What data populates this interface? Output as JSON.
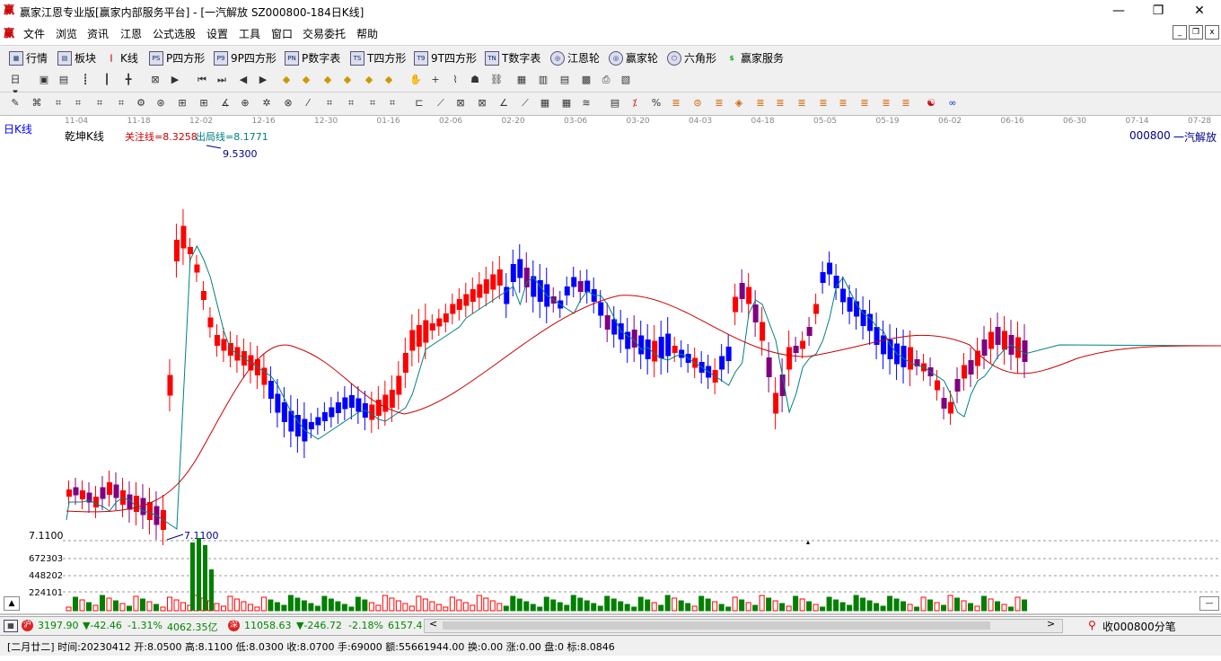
{
  "titlebar": {
    "title": "赢家江恩专业版[赢家内部服务平台] - [一汽解放  SZ000800-184日K线]",
    "logo": "赢"
  },
  "menu": [
    "文件",
    "浏览",
    "资讯",
    "江恩",
    "公式选股",
    "设置",
    "工具",
    "窗口",
    "交易委托",
    "帮助"
  ],
  "toolbar1": [
    "行情",
    "板块",
    "K线",
    "P四方形",
    "9P四方形",
    "P数字表",
    "T四方形",
    "9T四方形",
    "T数字表",
    "江恩轮",
    "赢家轮",
    "六角形",
    "赢家服务"
  ],
  "chart": {
    "period": "日K线",
    "indicator_name": "乾坤K线",
    "indicator_v1": "关注线=8.3258",
    "indicator_v2": "出局线=8.1771",
    "stock_code": "000800",
    "stock_name": "一汽解放",
    "high_label": "9.5300",
    "low_label": "7.1100",
    "axis_low": "7.1100",
    "vol_labels": [
      "672303",
      "448202",
      "224101"
    ],
    "dates": [
      "11-04",
      "11-18",
      "12-02",
      "12-16",
      "12-30",
      "01-16",
      "02-06",
      "02-20",
      "03-06",
      "03-20",
      "04-03",
      "04-18",
      "05-05",
      "05-19",
      "06-02",
      "06-16",
      "06-30",
      "07-14",
      "07-28"
    ]
  },
  "bottom": {
    "sh_value": "3197.90",
    "sh_change": "▼-42.46",
    "sh_pct": "-1.31%",
    "sh_amount": "4062.35亿",
    "sz_value": "11058.63",
    "sz_change": "▼-246.72",
    "sz_pct": "-2.18%",
    "sz_amount": "6157.4",
    "ticks_label": "收000800分笔",
    "status": "[二月廿二] 时间:20230412 开:8.0500 高:8.1100 低:8.0300 收:8.0700 手:69000 额:55661944.00 换:0.00 涨:0.00 盘:0 标:8.0846"
  }
}
